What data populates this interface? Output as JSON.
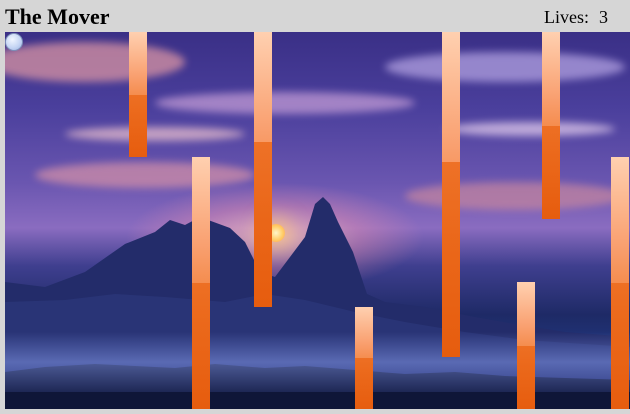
{
  "game": {
    "title": "The Mover",
    "lives_label": "Lives:",
    "lives_value": "3"
  },
  "colors": {
    "header_bg": "#d6d6d6",
    "bar_light": "#ffd0b0",
    "bar_dark": "#e86010",
    "player": "#c6d6f4"
  },
  "icons": {
    "player": "player-ball-icon",
    "bar": "obstacle-bar-icon"
  }
}
